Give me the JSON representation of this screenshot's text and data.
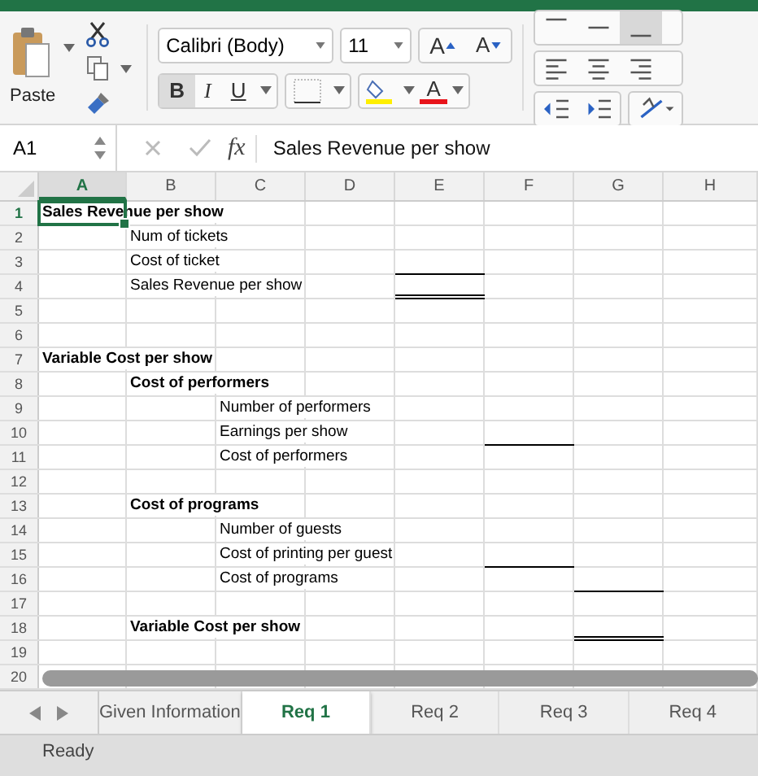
{
  "ribbon": {
    "paste_label": "Paste",
    "font_name": "Calibri (Body)",
    "font_size": "11",
    "grow_font": "A",
    "shrink_font": "A",
    "bold": "B",
    "italic": "I",
    "underline": "U",
    "font_color": "A",
    "vertical_align": [
      {
        "kind": "top",
        "selected": false
      },
      {
        "kind": "middle",
        "selected": false
      },
      {
        "kind": "bottom",
        "selected": true
      }
    ]
  },
  "formula_bar": {
    "name_box": "A1",
    "fx": "fx",
    "content": "Sales Revenue per show"
  },
  "columns": [
    {
      "label": "A",
      "selected": true
    },
    {
      "label": "B",
      "selected": false
    },
    {
      "label": "C",
      "selected": false
    },
    {
      "label": "D",
      "selected": false
    },
    {
      "label": "E",
      "selected": false
    },
    {
      "label": "F",
      "selected": false
    },
    {
      "label": "G",
      "selected": false
    },
    {
      "label": "H",
      "selected": false
    }
  ],
  "rows": [
    {
      "number": "1",
      "selected": true,
      "cells": [
        {
          "text": "Sales Revenue per show",
          "bold": true,
          "selected": true
        },
        {},
        {},
        {},
        {},
        {},
        {},
        {}
      ]
    },
    {
      "number": "2",
      "selected": false,
      "cells": [
        {},
        {
          "text": "Num of tickets",
          "bold": false
        },
        {},
        {},
        {},
        {},
        {},
        {}
      ]
    },
    {
      "number": "3",
      "selected": false,
      "cells": [
        {},
        {
          "text": "Cost of ticket",
          "bold": false
        },
        {},
        {},
        {
          "bottom_border": true
        },
        {},
        {},
        {}
      ]
    },
    {
      "number": "4",
      "selected": false,
      "cells": [
        {},
        {
          "text": "Sales Revenue per show",
          "bold": false
        },
        {},
        {},
        {
          "double_border": true
        },
        {},
        {},
        {}
      ]
    },
    {
      "number": "5",
      "selected": false,
      "cells": [
        {},
        {},
        {},
        {},
        {},
        {},
        {},
        {}
      ]
    },
    {
      "number": "6",
      "selected": false,
      "cells": [
        {},
        {},
        {},
        {},
        {},
        {},
        {},
        {}
      ]
    },
    {
      "number": "7",
      "selected": false,
      "cells": [
        {
          "text": "Variable Cost per show",
          "bold": true
        },
        {},
        {},
        {},
        {},
        {},
        {},
        {}
      ]
    },
    {
      "number": "8",
      "selected": false,
      "cells": [
        {},
        {
          "text": "Cost of performers",
          "bold": true
        },
        {},
        {},
        {},
        {},
        {},
        {}
      ]
    },
    {
      "number": "9",
      "selected": false,
      "cells": [
        {},
        {},
        {
          "text": "Number of performers",
          "bold": false
        },
        {},
        {},
        {},
        {},
        {}
      ]
    },
    {
      "number": "10",
      "selected": false,
      "cells": [
        {},
        {},
        {
          "text": "Earnings per show",
          "bold": false
        },
        {},
        {},
        {
          "bottom_border": true
        },
        {},
        {}
      ]
    },
    {
      "number": "11",
      "selected": false,
      "cells": [
        {},
        {},
        {
          "text": "Cost of performers",
          "bold": false
        },
        {},
        {},
        {},
        {},
        {}
      ]
    },
    {
      "number": "12",
      "selected": false,
      "cells": [
        {},
        {},
        {},
        {},
        {},
        {},
        {},
        {}
      ]
    },
    {
      "number": "13",
      "selected": false,
      "cells": [
        {},
        {
          "text": "Cost of programs",
          "bold": true
        },
        {},
        {},
        {},
        {},
        {},
        {}
      ]
    },
    {
      "number": "14",
      "selected": false,
      "cells": [
        {},
        {},
        {
          "text": "Number of guests",
          "bold": false
        },
        {},
        {},
        {},
        {},
        {}
      ]
    },
    {
      "number": "15",
      "selected": false,
      "cells": [
        {},
        {},
        {
          "text": "Cost of printing per guest",
          "bold": false
        },
        {},
        {},
        {
          "bottom_border": true
        },
        {},
        {}
      ]
    },
    {
      "number": "16",
      "selected": false,
      "cells": [
        {},
        {},
        {
          "text": "Cost of programs",
          "bold": false
        },
        {},
        {},
        {},
        {
          "bottom_border": true
        },
        {}
      ]
    },
    {
      "number": "17",
      "selected": false,
      "cells": [
        {},
        {},
        {},
        {},
        {},
        {},
        {},
        {}
      ]
    },
    {
      "number": "18",
      "selected": false,
      "cells": [
        {},
        {
          "text": "Variable Cost per show",
          "bold": true
        },
        {},
        {},
        {},
        {},
        {
          "double_border": true
        },
        {}
      ]
    },
    {
      "number": "19",
      "selected": false,
      "cells": [
        {},
        {},
        {},
        {},
        {},
        {},
        {},
        {}
      ]
    },
    {
      "number": "20",
      "selected": false,
      "cells": [
        {},
        {},
        {},
        {},
        {},
        {},
        {},
        {}
      ]
    }
  ],
  "sheet_tabs": [
    {
      "label": "Given Information",
      "selected": false
    },
    {
      "label": "Req 1",
      "selected": true
    },
    {
      "label": "Req 2",
      "selected": false
    },
    {
      "label": "Req 3",
      "selected": false
    },
    {
      "label": "Req 4",
      "selected": false
    }
  ],
  "status_bar": {
    "text": "Ready"
  }
}
